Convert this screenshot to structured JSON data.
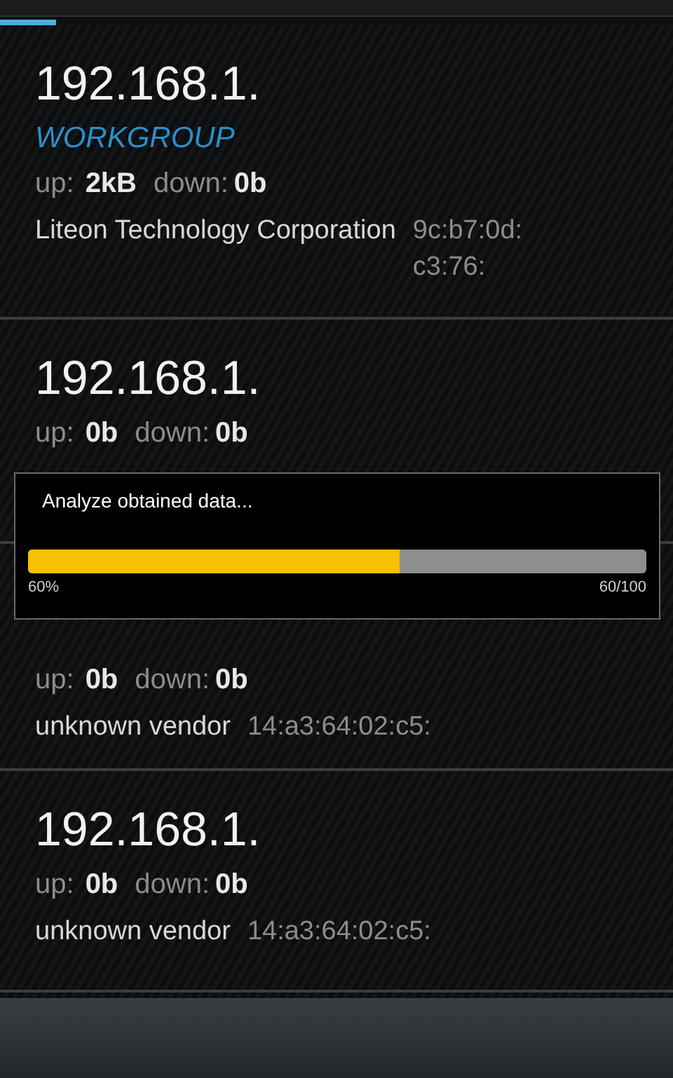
{
  "hosts": [
    {
      "ip": "192.168.1.",
      "workgroup": "WORKGROUP",
      "up_label": "up:",
      "up": "2kB",
      "down_label": "down:",
      "down": "0b",
      "vendor": "Liteon Technology Corporation",
      "mac": "9c:b7:0d:\nc3:76:"
    },
    {
      "ip": "192.168.1.",
      "up_label": "up:",
      "up": "0b",
      "down_label": "down:",
      "down": "0b"
    },
    {
      "up_label": "up:",
      "up": "0b",
      "down_label": "down:",
      "down": "0b",
      "vendor": "unknown vendor",
      "mac": "14:a3:64:02:c5:"
    },
    {
      "ip": "192.168.1.",
      "up_label": "up:",
      "up": "0b",
      "down_label": "down:",
      "down": "0b",
      "vendor": "unknown vendor",
      "mac": "14:a3:64:02:c5:"
    }
  ],
  "progress_dialog": {
    "message": "Analyze obtained data...",
    "level": 0.6,
    "percent": "60%",
    "count": "60/100"
  }
}
